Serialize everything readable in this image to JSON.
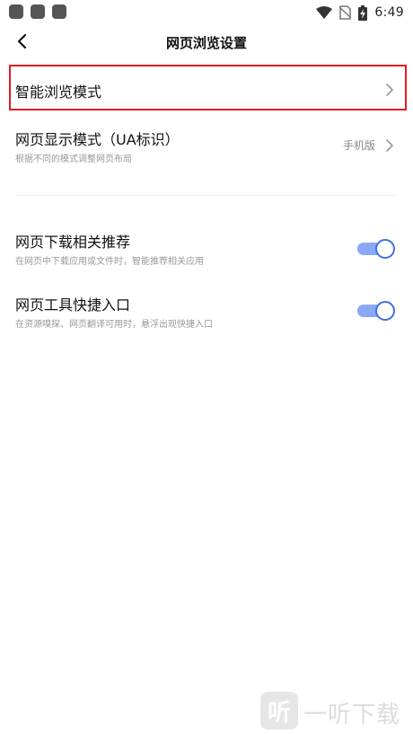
{
  "status_bar": {
    "time": "6:49",
    "icons": [
      "wifi-icon",
      "no-sim-icon",
      "battery-charging-icon"
    ]
  },
  "header": {
    "title": "网页浏览设置",
    "back_icon": "chevron-left-icon"
  },
  "settings": {
    "smart_browse": {
      "title": "智能浏览模式"
    },
    "display_mode": {
      "title": "网页显示模式（UA标识）",
      "subtitle": "根据不同的模式调整网页布局",
      "value": "手机版"
    },
    "download_recommend": {
      "title": "网页下载相关推荐",
      "subtitle": "在网页中下载应用或文件时，智能推荐相关应用",
      "enabled": true
    },
    "tools_entry": {
      "title": "网页工具快捷入口",
      "subtitle": "在资源嗅探、网页翻译可用时，悬浮出现快捷入口",
      "enabled": true
    }
  },
  "colors": {
    "accent": "#3f6fe6",
    "toggle_track": "#8aa8f5",
    "highlight": "#e51c23"
  },
  "watermark": {
    "logo_char": "听",
    "text": "一听下载"
  }
}
